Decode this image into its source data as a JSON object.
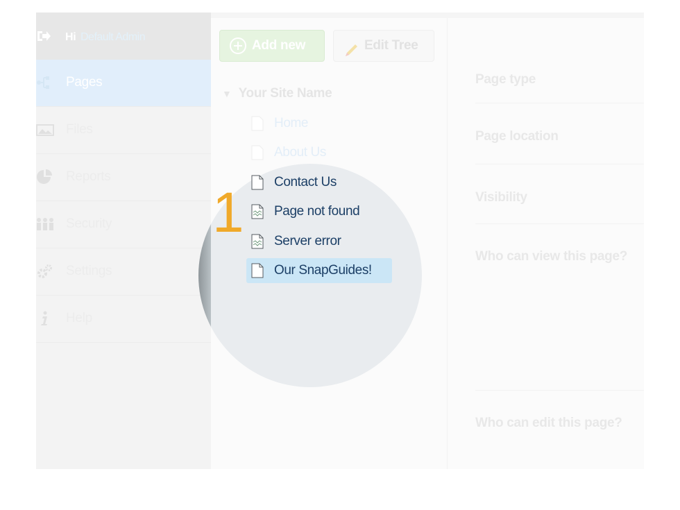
{
  "header": {
    "greeting": "Hi",
    "username": "Default Admin"
  },
  "sidebar": {
    "items": [
      {
        "label": "Pages",
        "icon": "pages-icon",
        "active": true
      },
      {
        "label": "Files",
        "icon": "files-icon"
      },
      {
        "label": "Reports",
        "icon": "reports-icon"
      },
      {
        "label": "Security",
        "icon": "security-icon"
      },
      {
        "label": "Settings",
        "icon": "settings-icon"
      },
      {
        "label": "Help",
        "icon": "help-icon"
      }
    ]
  },
  "toolbar": {
    "add_label": "Add new",
    "edit_label": "Edit Tree"
  },
  "tree": {
    "root": "Your Site Name",
    "items": [
      {
        "label": "Home"
      },
      {
        "label": "About Us"
      },
      {
        "label": "Contact Us"
      },
      {
        "label": "Page not found"
      },
      {
        "label": "Server error"
      },
      {
        "label": "Our SnapGuides!"
      }
    ]
  },
  "step_number": "1",
  "settings": {
    "page_type": "Page type",
    "page_location": "Page location",
    "visibility": "Visibility",
    "who_view": "Who can view this page?",
    "who_edit": "Who can edit this page?"
  },
  "colors": {
    "accent": "#f0a92a",
    "selection": "#cbe6f6",
    "link": "#1c3f66"
  }
}
